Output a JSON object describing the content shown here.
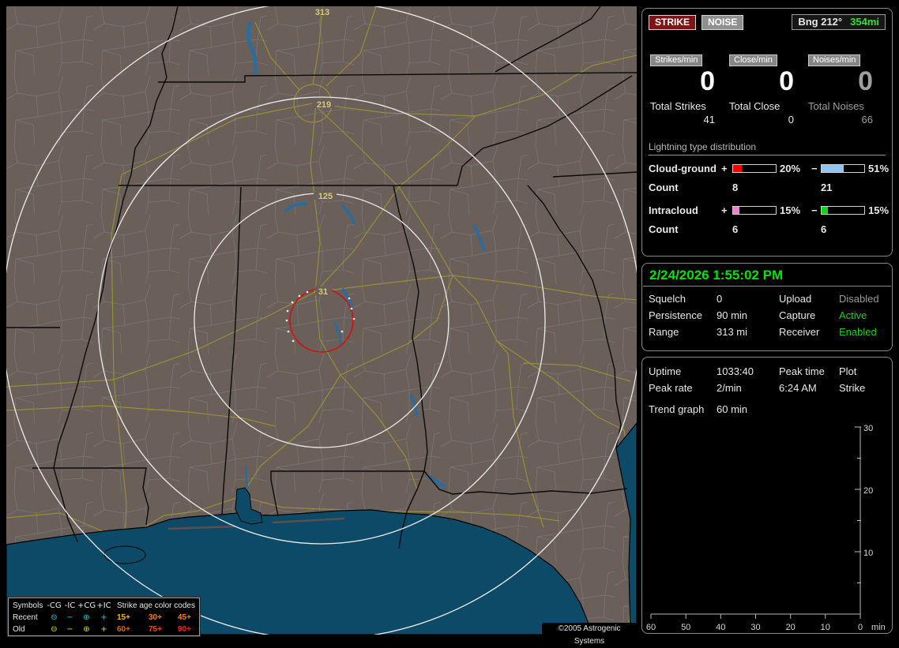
{
  "colors": {
    "accent_green": "#00e400",
    "status_green": "#1ad11a",
    "status_gray": "#9a9a9a",
    "cg_pos_bar": "#f20000",
    "cg_neg_bar": "#8fc3f0",
    "ic_pos_bar": "#ef7fd0",
    "ic_neg_bar": "#1ad11a",
    "recent_symbols": "#00dcdc",
    "old_symbols": "#dede00"
  },
  "map": {
    "ring_labels": {
      "r313": "313",
      "r219": "219",
      "r125": "125",
      "r31": "31"
    },
    "legend": {
      "symbols_header": "Symbols",
      "col_headers": [
        "-CG",
        "-IC",
        "+CG",
        "+IC"
      ],
      "age_header": "Strike age color codes",
      "recent_label": "Recent",
      "old_label": "Old",
      "symbols": [
        "⊖",
        "−",
        "⊕",
        "+"
      ],
      "recent_ages": [
        "15+",
        "30+",
        "45+"
      ],
      "old_ages": [
        "60+",
        "75+",
        "90+"
      ],
      "recent_age_colors": [
        "#ffb400",
        "#ff7d00",
        "#ff7a00"
      ],
      "old_age_colors": [
        "#dc6400",
        "#ff4600",
        "#ff1e00"
      ]
    },
    "copyright": "©2005 Astrogenic Systems"
  },
  "panel1": {
    "strike_button": "STRIKE",
    "noise_button": "NOISE",
    "bearing_label": "Bng 212°",
    "bearing_distance": "354mi",
    "counters": [
      {
        "label": "Strikes/min",
        "value": "0",
        "total_label": "Total Strikes",
        "total": "41"
      },
      {
        "label": "Close/min",
        "value": "0",
        "total_label": "Total Close",
        "total": "0"
      },
      {
        "label": "Noises/min",
        "value": "0",
        "total_label": "Total Noises",
        "total": "66"
      }
    ],
    "distribution": {
      "title": "Lightning type distribution",
      "cg_label": "Cloud-ground",
      "ic_label": "Intracloud",
      "count_label": "Count",
      "plus": "+",
      "minus": "−",
      "cg_pos": {
        "pct": 20,
        "text": "20%",
        "count": "8"
      },
      "cg_neg": {
        "pct": 51,
        "text": "51%",
        "count": "21"
      },
      "ic_pos": {
        "pct": 15,
        "text": "15%",
        "count": "6"
      },
      "ic_neg": {
        "pct": 15,
        "text": "15%",
        "count": "6"
      }
    }
  },
  "panel2": {
    "datetime": "2/24/2026 1:55:02 PM",
    "rows": [
      [
        "Squelch",
        "0",
        "Upload",
        "Disabled"
      ],
      [
        "Persistence",
        "90 min",
        "Capture",
        "Active"
      ],
      [
        "Range",
        "313 mi",
        "Receiver",
        "Enabled"
      ]
    ]
  },
  "panel3": {
    "rows": [
      [
        "Uptime",
        "1033:40",
        "Peak time",
        "Plot"
      ],
      [
        "Peak rate",
        "2/min",
        "6:24 AM",
        "Strike"
      ]
    ],
    "trend_label": "Trend graph",
    "trend_value": "60 min",
    "graph": {
      "y_ticks": [
        "30",
        "20",
        "10"
      ],
      "x_ticks": [
        "60",
        "50",
        "40",
        "30",
        "20",
        "10",
        "0"
      ],
      "x_unit": "min",
      "y_range": [
        0,
        30
      ],
      "x_range_min": [
        60,
        0
      ]
    }
  }
}
